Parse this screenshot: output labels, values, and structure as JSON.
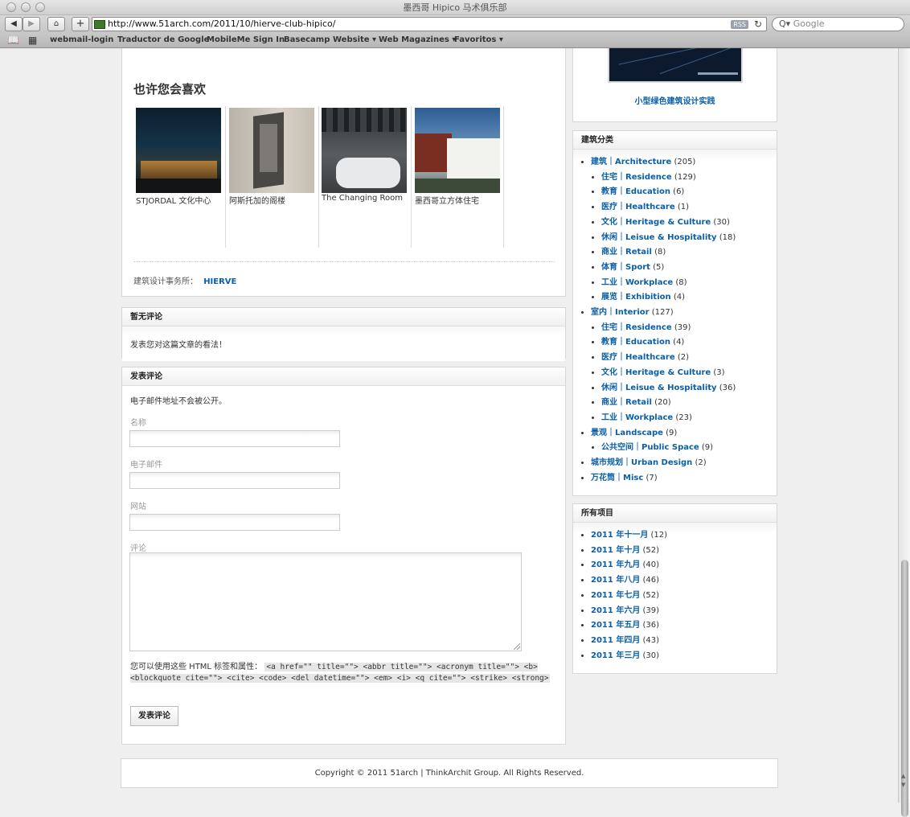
{
  "browser": {
    "window_title": "墨西哥 Hipico 马术俱乐部",
    "url": "http://www.51arch.com/2011/10/hierve-club-hipico/",
    "rss_label": "RSS",
    "search_placeholder": "Google",
    "bookmarks": [
      "webmail-login",
      "Traductor de Google",
      "MobileMe Sign In",
      "Basecamp",
      "Website ▾",
      "Web Magazines ▾",
      "Favoritos ▾"
    ]
  },
  "related": {
    "title": "也许您会喜欢",
    "items": [
      {
        "caption": "STJORDAL 文化中心"
      },
      {
        "caption": "阿斯托加的阁楼"
      },
      {
        "caption": "The Changing Room"
      },
      {
        "caption": "墨西哥立方体住宅"
      }
    ]
  },
  "architect": {
    "label": "建筑设计事务所：",
    "name": "HIERVE"
  },
  "comments": {
    "heading": "暂无评论",
    "empty_text": "发表您对这篇文章的看法！"
  },
  "comment_form": {
    "heading": "发表评论",
    "note": "电子邮件地址不会被公开。",
    "name_label": "名称",
    "email_label": "电子邮件",
    "website_label": "网站",
    "comment_label": "评论",
    "allowed_intro": "您可以使用这些 HTML 标签和属性：",
    "allowed_tags": "<a href=\"\" title=\"\"> <abbr title=\"\"> <acronym title=\"\"> <b> <blockquote cite=\"\"> <cite> <code> <del datetime=\"\"> <em> <i> <q cite=\"\"> <strike> <strong>",
    "submit_label": "发表评论"
  },
  "footer": {
    "copyright": "Copyright © 2011 51arch | ThinkArchit Group. All Rights Reserved."
  },
  "sidebar": {
    "book_title": "小型绿色建筑设计实践",
    "categories_heading": "建筑分类",
    "categories": [
      {
        "label": "建筑｜Architecture",
        "count": "(205)",
        "children": [
          {
            "label": "住宅｜Residence",
            "count": "(129)"
          },
          {
            "label": "教育｜Education",
            "count": "(6)"
          },
          {
            "label": "医疗｜Healthcare",
            "count": "(1)"
          },
          {
            "label": "文化｜Heritage & Culture",
            "count": "(30)"
          },
          {
            "label": "休闲｜Leisue & Hospitality",
            "count": "(18)"
          },
          {
            "label": "商业｜Retail",
            "count": "(8)"
          },
          {
            "label": "体育｜Sport",
            "count": "(5)"
          },
          {
            "label": "工业｜Workplace",
            "count": "(8)"
          },
          {
            "label": "展览｜Exhibition",
            "count": "(4)"
          }
        ]
      },
      {
        "label": "室内｜Interior",
        "count": "(127)",
        "children": [
          {
            "label": "住宅｜Residence",
            "count": "(39)"
          },
          {
            "label": "教育｜Education",
            "count": "(4)"
          },
          {
            "label": "医疗｜Healthcare",
            "count": "(2)"
          },
          {
            "label": "文化｜Heritage & Culture",
            "count": "(3)"
          },
          {
            "label": "休闲｜Leisue & Hospitality",
            "count": "(36)"
          },
          {
            "label": "商业｜Retail",
            "count": "(20)"
          },
          {
            "label": "工业｜Workplace",
            "count": "(23)"
          }
        ]
      },
      {
        "label": "景观｜Landscape",
        "count": "(9)",
        "children": [
          {
            "label": "公共空间｜Public Space",
            "count": "(9)"
          }
        ]
      },
      {
        "label": "城市规划｜Urban Design",
        "count": "(2)",
        "children": []
      },
      {
        "label": "万花筒｜Misc",
        "count": "(7)",
        "children": []
      }
    ],
    "archive_heading": "所有项目",
    "archive": [
      {
        "label": "2011 年十一月",
        "count": "(12)"
      },
      {
        "label": "2011 年十月",
        "count": "(52)"
      },
      {
        "label": "2011 年九月",
        "count": "(40)"
      },
      {
        "label": "2011 年八月",
        "count": "(46)"
      },
      {
        "label": "2011 年七月",
        "count": "(52)"
      },
      {
        "label": "2011 年六月",
        "count": "(39)"
      },
      {
        "label": "2011 年五月",
        "count": "(36)"
      },
      {
        "label": "2011 年四月",
        "count": "(43)"
      },
      {
        "label": "2011 年三月",
        "count": "(30)"
      }
    ]
  }
}
